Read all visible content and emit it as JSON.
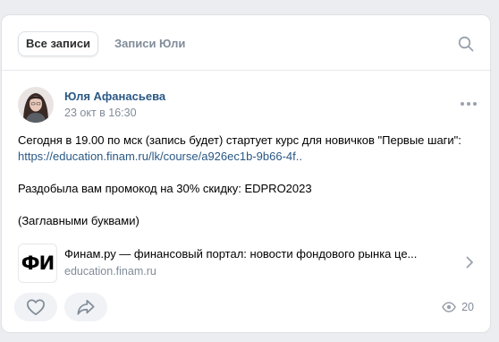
{
  "tabs": [
    {
      "label": "Все записи",
      "active": true
    },
    {
      "label": "Записи Юли",
      "active": false
    }
  ],
  "post": {
    "author": "Юля Афанасьева",
    "timestamp": "23 окт в 16:30",
    "text_lines": [
      "Сегодня в 19.00 по мск (запись будет) стартует курс для новичков \"Первые шаги\":",
      "https://education.finam.ru/lk/course/a926ec1b-9b66-4f..",
      "",
      "Раздобыла вам промокод на 30% скидку: EDPRO2023",
      "",
      "(Заглавными буквами)"
    ],
    "link_snippet": {
      "logo_text": "ФИ",
      "title": "Финам.ру — финансовый портал: новости фондового рынка це...",
      "domain": "education.finam.ru"
    },
    "views_count": "20"
  },
  "icons": {
    "search": "search-icon",
    "more": "more-dots-icon",
    "like": "heart-icon",
    "share": "share-arrow-icon",
    "views": "eye-icon",
    "chevron": "chevron-right-icon"
  },
  "colors": {
    "link": "#2a5885",
    "muted": "#818c99",
    "background": "#ebedf0",
    "button_bg": "#f0f2f5"
  }
}
